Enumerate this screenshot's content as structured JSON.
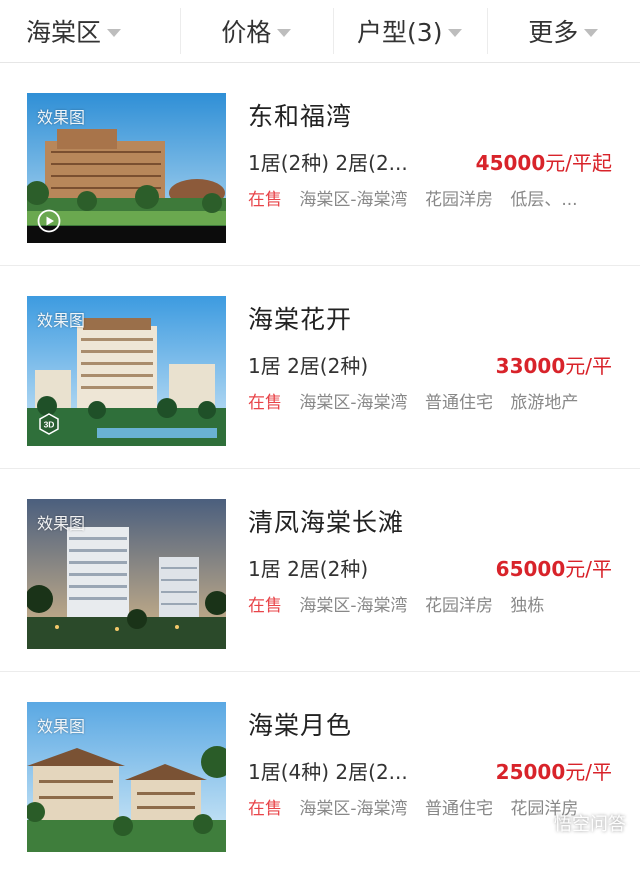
{
  "filters": [
    {
      "label": "海棠区"
    },
    {
      "label": "价格"
    },
    {
      "label": "户型(3)"
    },
    {
      "label": "更多"
    }
  ],
  "listings": [
    {
      "thumb_label": "效果图",
      "thumb_badge": "play-icon",
      "name": "东和福湾",
      "layout": "1居(2种) 2居(2...",
      "price_value": "45000",
      "price_unit": "元/平起",
      "status": "在售",
      "tags": [
        "海棠区-海棠湾",
        "花园洋房",
        "低层、..."
      ]
    },
    {
      "thumb_label": "效果图",
      "thumb_badge": "3d-view-icon",
      "name": "海棠花开",
      "layout": "1居 2居(2种)",
      "price_value": "33000",
      "price_unit": "元/平",
      "status": "在售",
      "tags": [
        "海棠区-海棠湾",
        "普通住宅",
        "旅游地产"
      ]
    },
    {
      "thumb_label": "效果图",
      "thumb_badge": "",
      "name": "清凤海棠长滩",
      "layout": "1居 2居(2种)",
      "price_value": "65000",
      "price_unit": "元/平",
      "status": "在售",
      "tags": [
        "海棠区-海棠湾",
        "花园洋房",
        "独栋"
      ]
    },
    {
      "thumb_label": "效果图",
      "thumb_badge": "",
      "name": "海棠月色",
      "layout": "1居(4种) 2居(2...",
      "price_value": "25000",
      "price_unit": "元/平",
      "status": "在售",
      "tags": [
        "海棠区-海棠湾",
        "普通住宅",
        "花园洋房"
      ]
    }
  ],
  "watermark": {
    "text": "悟空问答",
    "icon": "speech-bubble-icon"
  },
  "colors": {
    "price": "#d8232a",
    "status": "#e8454a",
    "tag": "#888888"
  }
}
